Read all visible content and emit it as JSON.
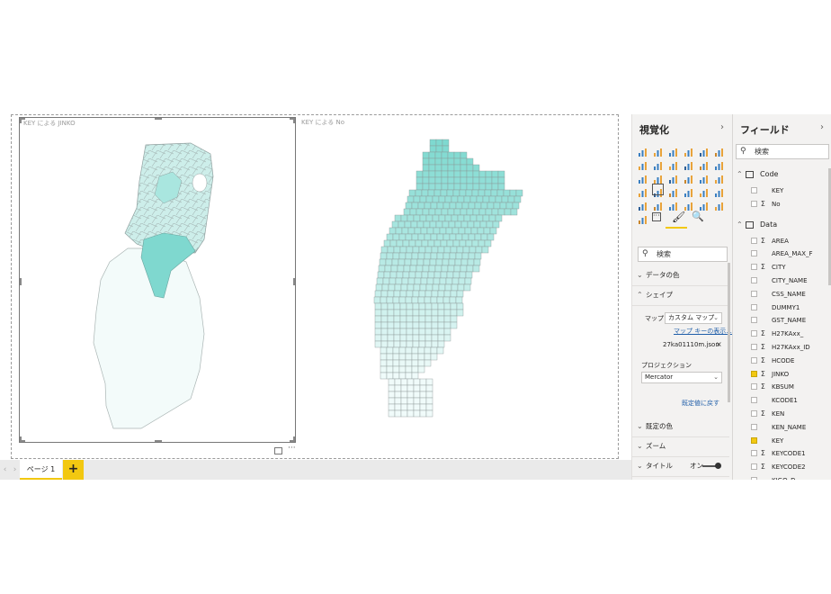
{
  "visuals": [
    {
      "title": "KEY による JINKO"
    },
    {
      "title": "KEY による No"
    }
  ],
  "page_tab": {
    "label": "ページ 1",
    "add": "+"
  },
  "nav": {
    "prev": "‹",
    "next": "›"
  },
  "viz_pane": {
    "title": "視覚化",
    "chevron": "›",
    "more": "···",
    "search_placeholder": "検索",
    "sections": {
      "data_colors": "データの色",
      "shape": "シェイプ",
      "default_colors": "既定の色",
      "zoom": "ズーム",
      "title": "タイトル"
    },
    "map_label": "マップ",
    "map_value": "カスタム マップ",
    "map_keys_link": "マップ キーの表示...",
    "file_name": "27ka01110m.json",
    "remove": "×",
    "projection_label": "プロジェクション",
    "projection_value": "Mercator",
    "reset_link": "既定値に戻す",
    "toggle_label": "オン",
    "icons": [
      "stacked-bar-icon",
      "stacked-column-icon",
      "clustered-bar-icon",
      "clustered-column-icon",
      "100-bar-icon",
      "100-column-icon",
      "line-icon",
      "area-icon",
      "stacked-area-icon",
      "line-column-icon",
      "line-clustered-icon",
      "ribbon-icon",
      "waterfall-icon",
      "scatter-icon",
      "pie-icon",
      "donut-icon",
      "treemap-icon",
      "map-icon",
      "filled-map-icon",
      "shape-map-icon",
      "funnel-icon",
      "gauge-icon",
      "card-icon",
      "multirow-card-icon",
      "kpi-icon",
      "slicer-icon",
      "table-icon",
      "matrix-icon",
      "r-visual-icon",
      "python-visual-icon",
      "globe-icon"
    ]
  },
  "fields_pane": {
    "title": "フィールド",
    "chevron": "›",
    "search_placeholder": "検索",
    "tables": [
      {
        "name": "Code",
        "fields": [
          {
            "name": "KEY",
            "sigma": "",
            "checked": false
          },
          {
            "name": "No",
            "sigma": "Σ",
            "checked": false
          }
        ]
      },
      {
        "name": "Data",
        "fields": [
          {
            "name": "AREA",
            "sigma": "Σ",
            "checked": false
          },
          {
            "name": "AREA_MAX_F",
            "sigma": "",
            "checked": false
          },
          {
            "name": "CITY",
            "sigma": "Σ",
            "checked": false
          },
          {
            "name": "CITY_NAME",
            "sigma": "",
            "checked": false
          },
          {
            "name": "CSS_NAME",
            "sigma": "",
            "checked": false
          },
          {
            "name": "DUMMY1",
            "sigma": "",
            "checked": false
          },
          {
            "name": "GST_NAME",
            "sigma": "",
            "checked": false
          },
          {
            "name": "H27KAxx_",
            "sigma": "Σ",
            "checked": false
          },
          {
            "name": "H27KAxx_ID",
            "sigma": "Σ",
            "checked": false
          },
          {
            "name": "HCODE",
            "sigma": "Σ",
            "checked": false
          },
          {
            "name": "JINKO",
            "sigma": "Σ",
            "checked": true
          },
          {
            "name": "KBSUM",
            "sigma": "Σ",
            "checked": false
          },
          {
            "name": "KCODE1",
            "sigma": "",
            "checked": false
          },
          {
            "name": "KEN",
            "sigma": "Σ",
            "checked": false
          },
          {
            "name": "KEN_NAME",
            "sigma": "",
            "checked": false
          },
          {
            "name": "KEY",
            "sigma": "",
            "checked": true
          },
          {
            "name": "KEYCODE1",
            "sigma": "Σ",
            "checked": false
          },
          {
            "name": "KEYCODE2",
            "sigma": "Σ",
            "checked": false
          },
          {
            "name": "KIGO_D",
            "sigma": "",
            "checked": false
          }
        ]
      }
    ]
  },
  "colors": {
    "accent": "#f2c811",
    "map_fill_light": "#eefaf8",
    "map_fill_dark": "#7ed9d0"
  }
}
